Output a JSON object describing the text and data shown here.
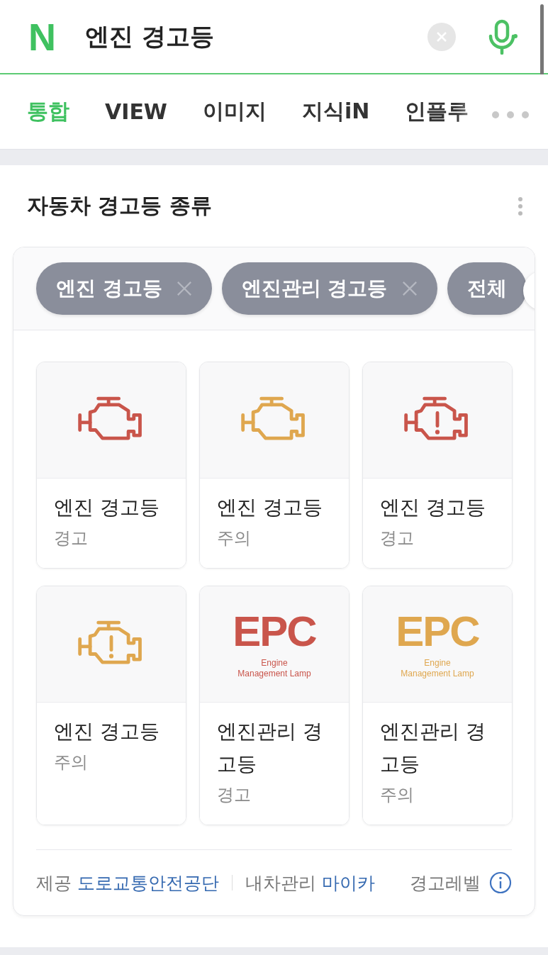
{
  "search": {
    "logo": "N",
    "query": "엔진 경고등"
  },
  "tabs": [
    {
      "label": "통합",
      "selected": true
    },
    {
      "label": "VIEW",
      "selected": false
    },
    {
      "label": "이미지",
      "selected": false
    },
    {
      "label": "지식iN",
      "selected": false
    },
    {
      "label": "인플루",
      "selected": false
    }
  ],
  "section": {
    "title": "자동차 경고등 종류",
    "chips": [
      {
        "label": "엔진 경고등",
        "removable": true
      },
      {
        "label": "엔진관리 경고등",
        "removable": true
      },
      {
        "label": "전체",
        "removable": false
      }
    ],
    "tiles": [
      {
        "kind": "engine",
        "alert": false,
        "color": "#c9554b",
        "name": "엔진 경고등",
        "grade": "경고"
      },
      {
        "kind": "engine",
        "alert": false,
        "color": "#dfa74f",
        "name": "엔진 경고등",
        "grade": "주의"
      },
      {
        "kind": "engine",
        "alert": true,
        "color": "#c9554b",
        "name": "엔진 경고등",
        "grade": "경고"
      },
      {
        "kind": "engine",
        "alert": true,
        "color": "#dfa74f",
        "name": "엔진 경고등",
        "grade": "주의"
      },
      {
        "kind": "epc",
        "color": "#c9554b",
        "symbol": "EPC",
        "caption": "Engine Management Lamp",
        "name": "엔진관리 경고등",
        "grade": "경고"
      },
      {
        "kind": "epc",
        "color": "#dfa74f",
        "symbol": "EPC",
        "caption": "Engine Management Lamp",
        "name": "엔진관리 경고등",
        "grade": "주의"
      }
    ],
    "footer": {
      "provider_label": "제공",
      "provider": "도로교통안전공단",
      "mycar_label": "내차관리",
      "mycar": "마이카",
      "legend": "경고레벨"
    }
  }
}
